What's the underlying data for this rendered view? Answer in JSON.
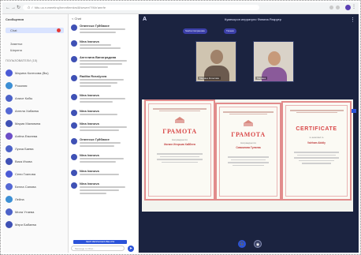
{
  "browser": {
    "url": "Ô ✓ fdtu.uo.rumeetinq/hmrnfiemkrs/8/sewer/?!Mn'amrfe"
  },
  "sidebar": {
    "title": "Сообщения",
    "items": [
      {
        "label": "Chat",
        "active": true,
        "badge": true
      },
      {
        "label": "Заметки",
        "active": false,
        "badge": false
      },
      {
        "label": "Ширина",
        "active": false,
        "badge": false
      }
    ],
    "section_label": "ПОЛЬЗОВАТЕЛИ (15)",
    "contacts": [
      {
        "name": "Марина Колесова (Вы)",
        "color": "#4b5bd6"
      },
      {
        "name": "Розалия",
        "color": "#3c8fd4"
      },
      {
        "name": "Алисе Кобы",
        "color": "#4c62c8"
      },
      {
        "name": "Ангела Хабаева",
        "color": "#5468d4"
      },
      {
        "name": "Мария Малявина",
        "color": "#3f51b5"
      },
      {
        "name": "Алёна Евсеева",
        "color": "#6c4ec7"
      },
      {
        "name": "Луиза Баева",
        "color": "#4c62c8"
      },
      {
        "name": "Вика Ичова",
        "color": "#3f51b5"
      },
      {
        "name": "Сени Гоилова",
        "color": "#4b5bd6"
      },
      {
        "name": "Белла Сапова",
        "color": "#5468d4"
      },
      {
        "name": "Лейла",
        "color": "#3c8fd4"
      },
      {
        "name": "Мила Утаева",
        "color": "#4c62c8"
      },
      {
        "name": "Мэри Бабаева",
        "color": "#3f51b5"
      }
    ]
  },
  "chat": {
    "header": "< Chat",
    "messages": [
      {
        "author": "Оганесья Гуйбакое",
        "time": "",
        "lines": [
          58,
          46
        ]
      },
      {
        "author": "Nina Ivanova",
        "time": "",
        "lines": [
          40,
          52
        ]
      },
      {
        "author": "Ангелина Виноградова",
        "time": "",
        "lines": [
          60,
          54,
          36
        ]
      },
      {
        "author": "Radika Rosslyova",
        "time": "",
        "lines": [
          56,
          48,
          40
        ]
      },
      {
        "author": "Nina Ivanova",
        "time": "",
        "lines": [
          58,
          42
        ]
      },
      {
        "author": "Nina Ivanova",
        "time": "",
        "lines": [
          48
        ]
      },
      {
        "author": "Nina Ivanova",
        "time": "",
        "lines": [
          60,
          50
        ]
      },
      {
        "author": "Оганесья Гуйбакое",
        "time": "",
        "lines": [
          52,
          44
        ]
      },
      {
        "author": "Nina Ivanova",
        "time": "",
        "lines": [
          56,
          46
        ]
      },
      {
        "author": "Nina Ivanova",
        "time": "",
        "lines": [
          50
        ]
      },
      {
        "author": "Nina Ivanova",
        "time": "",
        "lines": [
          58,
          50,
          34
        ]
      }
    ],
    "new_messages_button": "NEW MESSAGES BELOW",
    "input_placeholder": "Message to Chat..."
  },
  "conference": {
    "logo": "A",
    "title": "Кумекорон иерратуло Финина Разруер",
    "pills": [
      "Sasha Сапранова",
      "Тахеев"
    ],
    "participants": [
      {
        "name": "Марина Колесова"
      },
      {
        "name": "Марина"
      }
    ],
    "certificates": [
      {
        "title": "ГРАМОТА",
        "name": "Иоганн Игорьма Хайбеев",
        "recipient_label": "Награждается"
      },
      {
        "title": "ГРАМОТА",
        "name": "Сивоилова Гуляева",
        "recipient_label": "Награждается"
      },
      {
        "title": "CERTIFICATE",
        "name": "Valrham Abidiy",
        "recipient_label": "is awarded to"
      }
    ]
  },
  "colors": {
    "accent": "#2b53d9",
    "conference_bg": "#1b2340",
    "certificate_border": "#e28c8c",
    "certificate_title": "#d94848"
  }
}
